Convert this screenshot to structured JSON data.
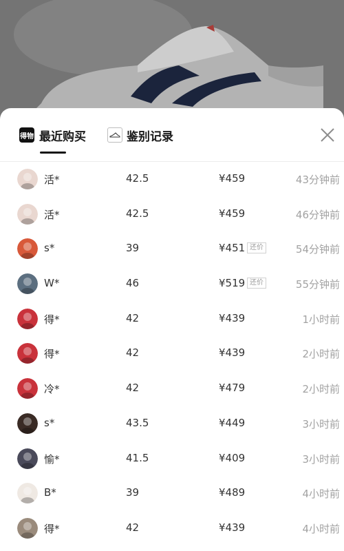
{
  "tabs": [
    {
      "label": "最近购买",
      "logo_text": "得物",
      "icon": "dewu-logo-icon",
      "active": true
    },
    {
      "label": "鉴别记录",
      "icon": "authentication-badge-icon",
      "active": false
    }
  ],
  "close_icon": "close-icon",
  "records": [
    {
      "user": "活*",
      "size": "42.5",
      "price": "¥459",
      "badge": "",
      "time": "43分钟前",
      "avatar_color": "#e9d7d0"
    },
    {
      "user": "活*",
      "size": "42.5",
      "price": "¥459",
      "badge": "",
      "time": "46分钟前",
      "avatar_color": "#e9d7d0"
    },
    {
      "user": "s*",
      "size": "39",
      "price": "¥451",
      "badge": "还价",
      "time": "54分钟前",
      "avatar_color": "#d8593a"
    },
    {
      "user": "W*",
      "size": "46",
      "price": "¥519",
      "badge": "还价",
      "time": "55分钟前",
      "avatar_color": "#5c6f80"
    },
    {
      "user": "得*",
      "size": "42",
      "price": "¥439",
      "badge": "",
      "time": "1小时前",
      "avatar_color": "#c9323b"
    },
    {
      "user": "得*",
      "size": "42",
      "price": "¥439",
      "badge": "",
      "time": "2小时前",
      "avatar_color": "#c9323b"
    },
    {
      "user": "冷*",
      "size": "42",
      "price": "¥479",
      "badge": "",
      "time": "2小时前",
      "avatar_color": "#c9323b"
    },
    {
      "user": "s*",
      "size": "43.5",
      "price": "¥449",
      "badge": "",
      "time": "3小时前",
      "avatar_color": "#3a2b25"
    },
    {
      "user": "愉*",
      "size": "41.5",
      "price": "¥409",
      "badge": "",
      "time": "3小时前",
      "avatar_color": "#4a4a5a"
    },
    {
      "user": "B*",
      "size": "39",
      "price": "¥489",
      "badge": "",
      "time": "4小时前",
      "avatar_color": "#efe9e3"
    },
    {
      "user": "得*",
      "size": "42",
      "price": "¥439",
      "badge": "",
      "time": "4小时前",
      "avatar_color": "#9a8b7c"
    }
  ]
}
